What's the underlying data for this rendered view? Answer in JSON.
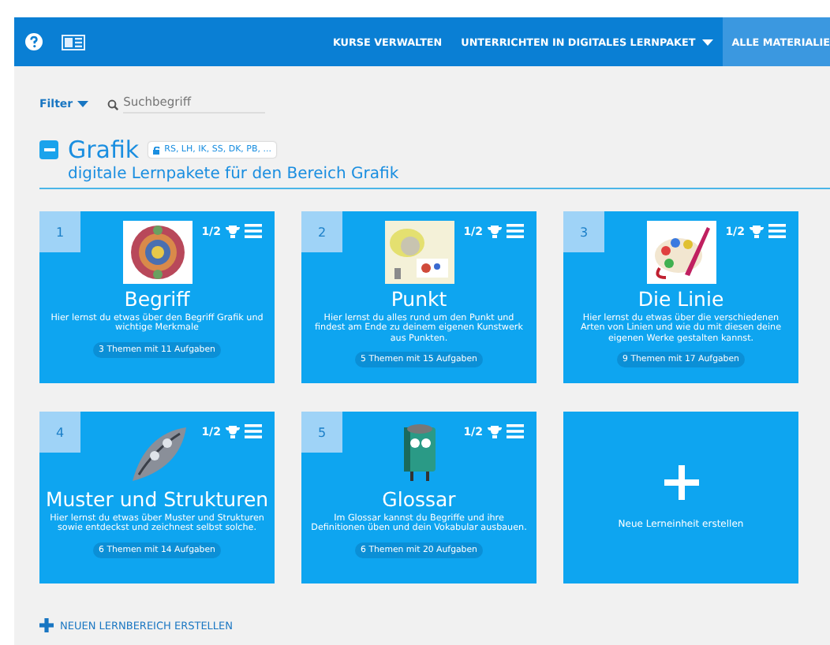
{
  "nav": {
    "items": [
      {
        "label": "KURSE VERWALTEN",
        "selected": false,
        "dropdown": false
      },
      {
        "label": "UNTERRICHTEN IN DIGITALES LERNPAKET",
        "selected": false,
        "dropdown": true
      },
      {
        "label": "ALLE MATERIALIE",
        "selected": true,
        "dropdown": false
      }
    ]
  },
  "toolbar": {
    "filter": "Filter",
    "search": {
      "placeholder": "Suchbegriff"
    }
  },
  "section": {
    "title": "Grafik",
    "expanded": true,
    "tag": "RS, LH, IK, SS, DK, PB, ...",
    "subtitle": "digitale Lernpakete für den Bereich Grafik",
    "cards": [
      {
        "number": "1",
        "progress": "1/2",
        "title": "Begriff",
        "description": "Hier lernst du etwas über den Begriff Grafik und wichtige Merkmale",
        "count": "3 Themen mit 11 Aufgaben"
      },
      {
        "number": "2",
        "progress": "1/2",
        "title": "Punkt",
        "description": "Hier lernst du alles rund um den Punkt und findest am Ende zu deinem eigenen Kunstwerk aus Punkten.",
        "count": "5 Themen mit 15 Aufgaben"
      },
      {
        "number": "3",
        "progress": "1/2",
        "title": "Die Linie",
        "description": "Hier lernst du etwas über die verschiedenen Arten von Linien und wie du mit diesen deine eigenen Werke gestalten kannst.",
        "count": "9 Themen mit 17 Aufgaben"
      },
      {
        "number": "4",
        "progress": "1/2",
        "title": "Muster und Strukturen",
        "description": "Hier lernst du etwas über Muster und Strukturen sowie entdeckst und zeichnest selbst solche.",
        "count": "6 Themen mit 14 Aufgaben"
      },
      {
        "number": "5",
        "progress": "1/2",
        "title": "Glossar",
        "description": "Im Glossar kannst du Begriffe und ihre Definitionen üben und dein Vokabular ausbauen.",
        "count": "6 Themen mit 20 Aufgaben"
      }
    ],
    "new_card": "Neue Lerneinheit erstellen"
  },
  "new_area": "NEUEN LERNBEREICH ERSTELLEN"
}
